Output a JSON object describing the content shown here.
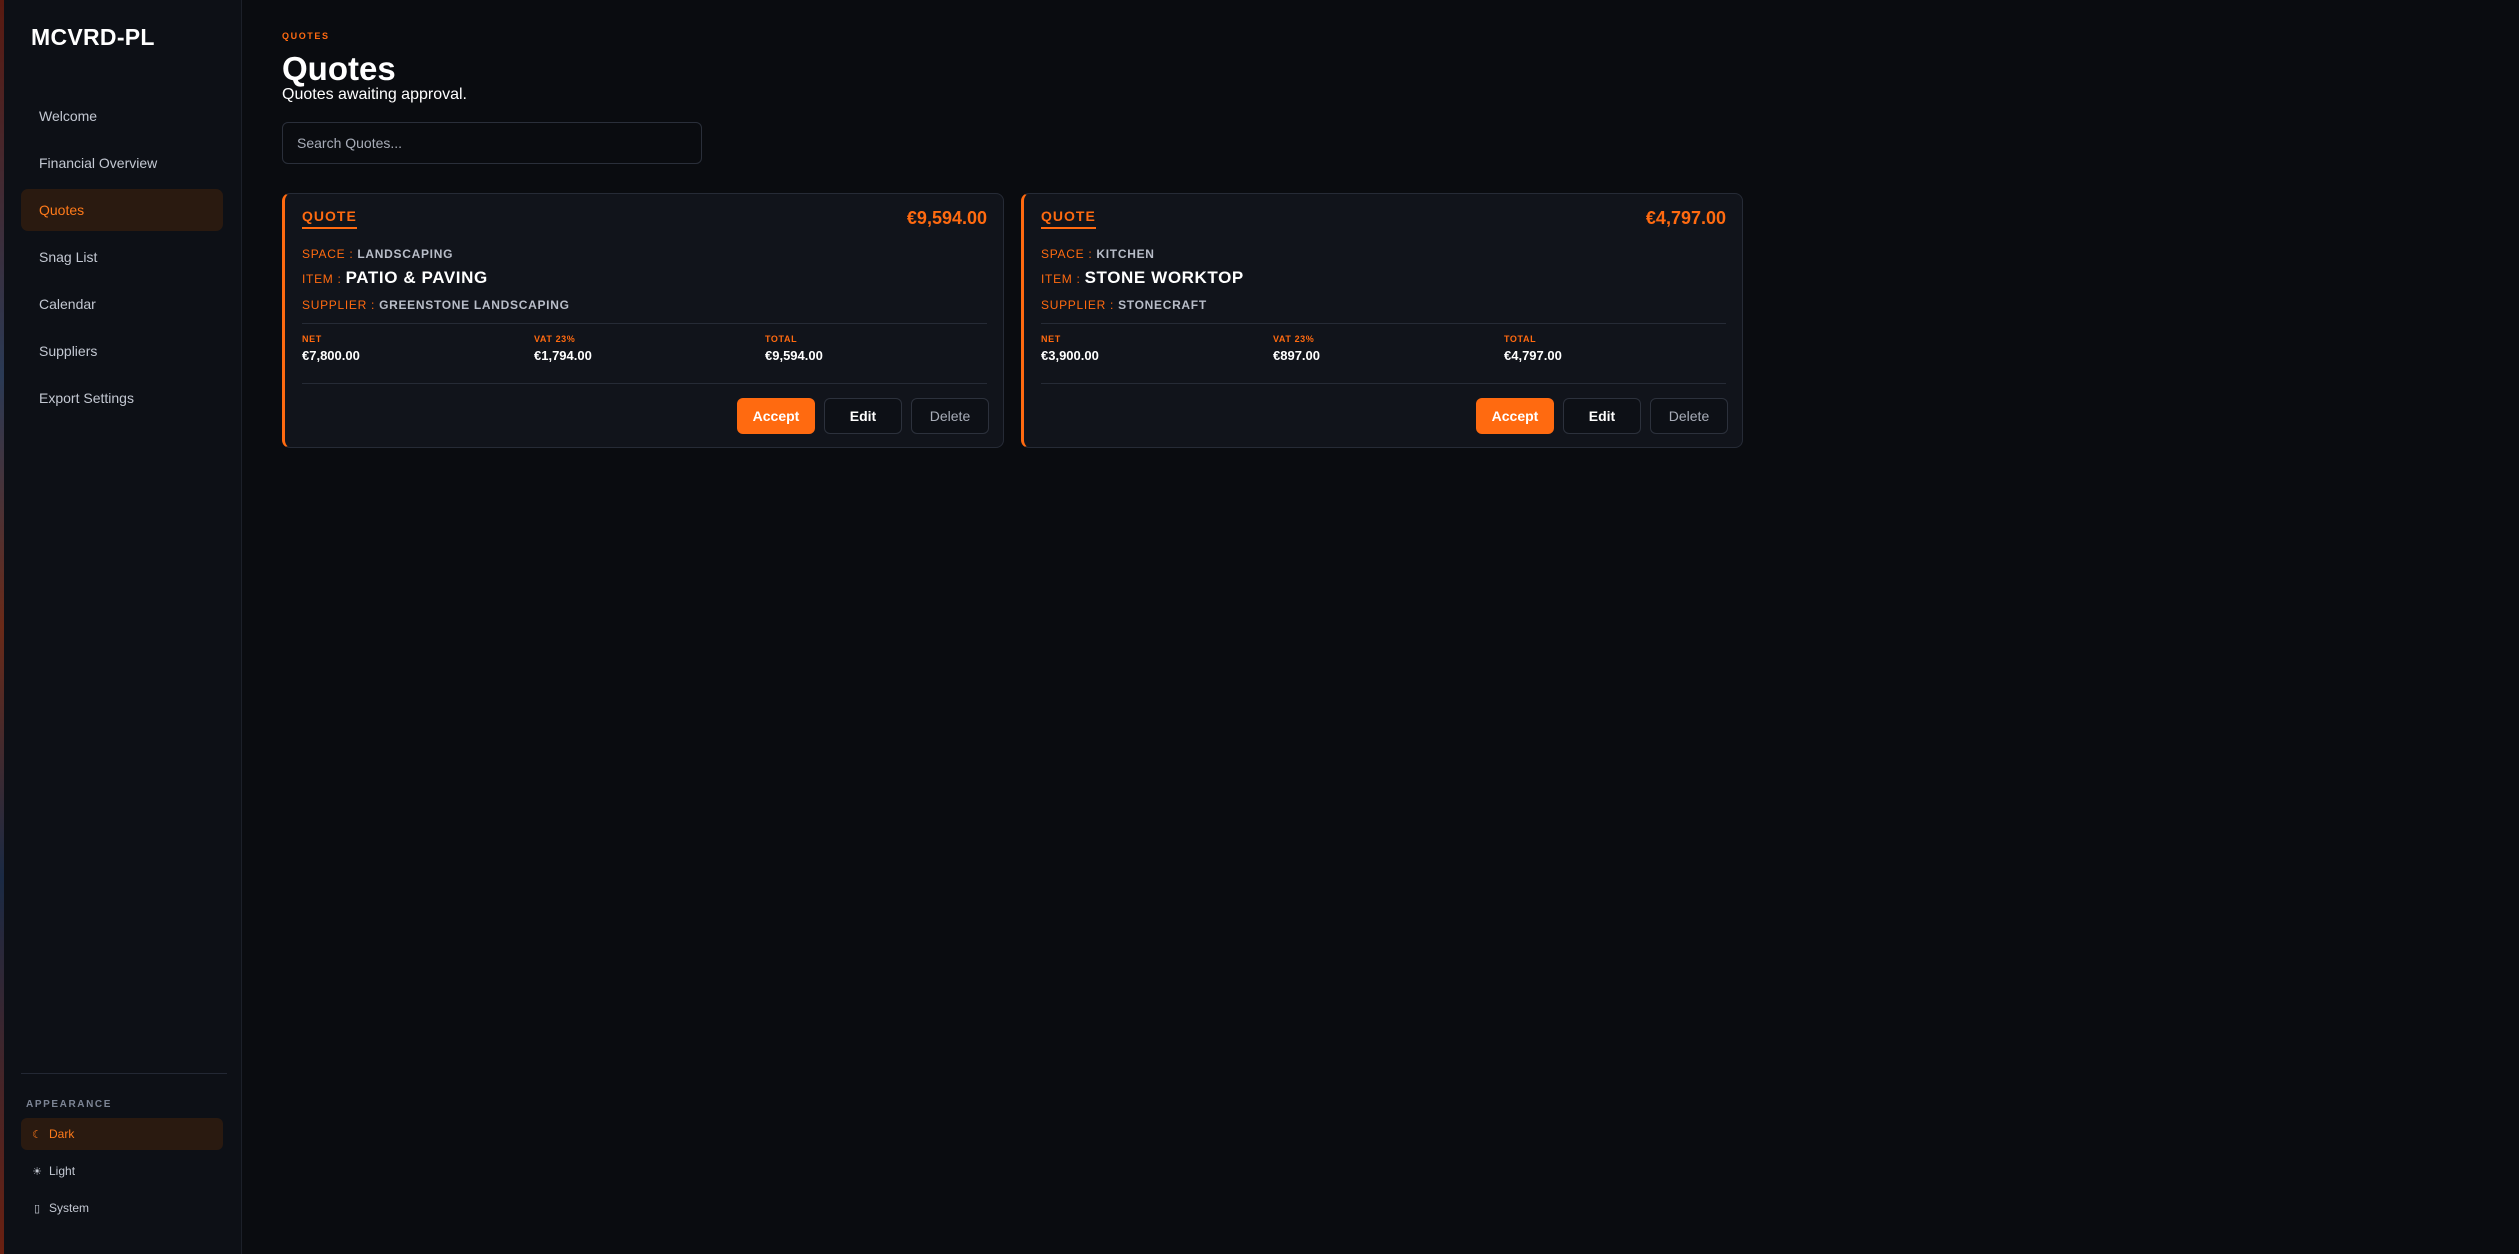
{
  "brand": "MCVRD-PL",
  "nav": [
    {
      "label": "Welcome",
      "active": false
    },
    {
      "label": "Financial Overview",
      "active": false
    },
    {
      "label": "Quotes",
      "active": true
    },
    {
      "label": "Snag List",
      "active": false
    },
    {
      "label": "Calendar",
      "active": false
    },
    {
      "label": "Suppliers",
      "active": false
    },
    {
      "label": "Export Settings",
      "active": false
    }
  ],
  "appearance": {
    "label": "APPEARANCE",
    "options": [
      {
        "label": "Dark",
        "icon": "moon-icon",
        "glyph": "☾",
        "active": true
      },
      {
        "label": "Light",
        "icon": "sun-icon",
        "glyph": "☀",
        "active": false
      },
      {
        "label": "System",
        "icon": "monitor-icon",
        "glyph": "▯",
        "active": false
      }
    ]
  },
  "page": {
    "eyebrow": "QUOTES",
    "title": "Quotes",
    "subtitle": "Quotes awaiting approval."
  },
  "search": {
    "placeholder": "Search Quotes...",
    "value": ""
  },
  "colors": {
    "accent": "#ff6a10",
    "background": "#0a0c10",
    "card": "#11141b",
    "sidebar": "#0d1016"
  },
  "quotes": [
    {
      "tag": "QUOTE",
      "amount": "€9,594.00",
      "space_label": "SPACE :",
      "space": "LANDSCAPING",
      "item_label": "ITEM :",
      "item": "PATIO & PAVING",
      "supplier_label": "SUPPLIER :",
      "supplier": "GREENSTONE LANDSCAPING",
      "net_label": "NET",
      "net": "€7,800.00",
      "vat_label": "VAT 23%",
      "vat": "€1,794.00",
      "total_label": "TOTAL",
      "total": "€9,594.00",
      "accept": "Accept",
      "edit": "Edit",
      "delete": "Delete"
    },
    {
      "tag": "QUOTE",
      "amount": "€4,797.00",
      "space_label": "SPACE :",
      "space": "KITCHEN",
      "item_label": "ITEM :",
      "item": "STONE WORKTOP",
      "supplier_label": "SUPPLIER :",
      "supplier": "STONECRAFT",
      "net_label": "NET",
      "net": "€3,900.00",
      "vat_label": "VAT 23%",
      "vat": "€897.00",
      "total_label": "TOTAL",
      "total": "€4,797.00",
      "accept": "Accept",
      "edit": "Edit",
      "delete": "Delete"
    }
  ]
}
